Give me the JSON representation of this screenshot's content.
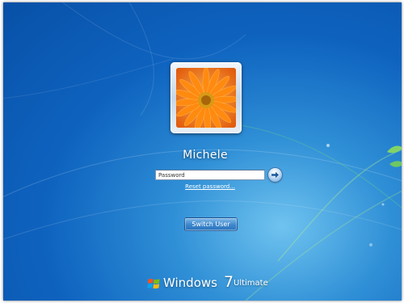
{
  "user": {
    "name": "Michele",
    "avatar_icon": "orange-gerbera-flower"
  },
  "password_field": {
    "placeholder": "Password",
    "value": ""
  },
  "submit_icon": "arrow-right-icon",
  "reset_password": {
    "label": "Reset password..."
  },
  "switch_user": {
    "label": "Switch User"
  },
  "branding": {
    "logo_icon": "windows-flag-icon",
    "name": "Windows",
    "version": "7",
    "edition": "Ultimate"
  },
  "colors": {
    "background_dark": "#0850a7",
    "background_light": "#6fc3ef",
    "flower_orange": "#f47a0f",
    "leaf_green": "#7ad34a"
  }
}
